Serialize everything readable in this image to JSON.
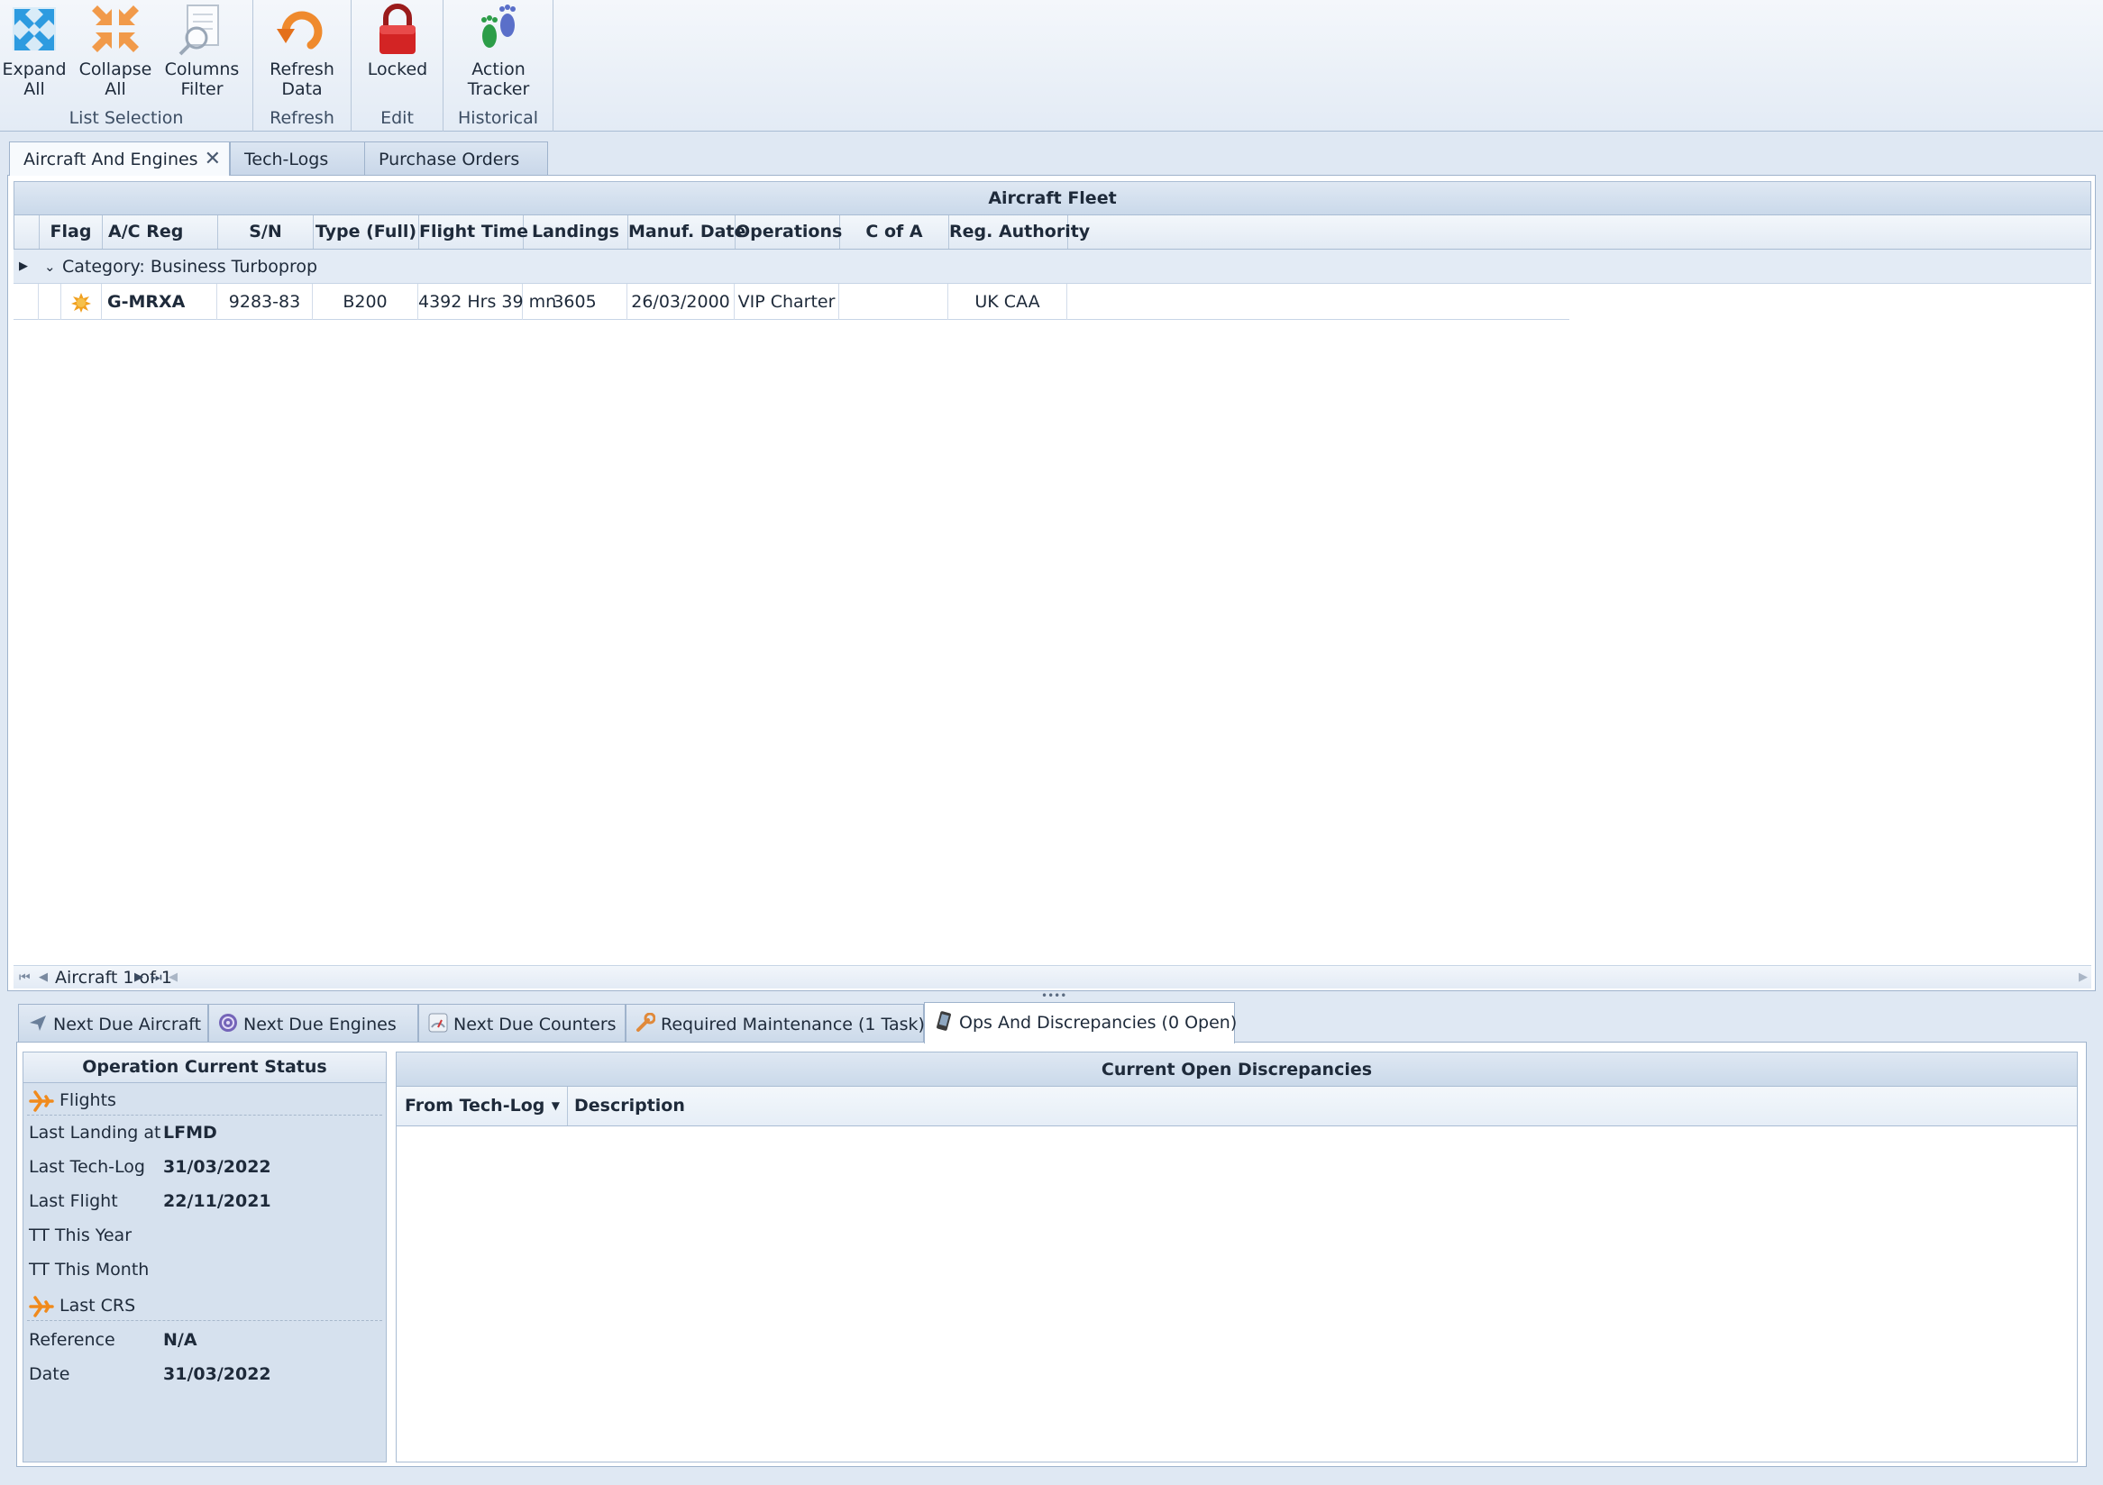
{
  "ribbon": {
    "groups": [
      {
        "label": "List Selection"
      },
      {
        "label": "Refresh"
      },
      {
        "label": "Edit"
      },
      {
        "label": "Historical"
      }
    ],
    "buttons": {
      "expand_all": "Expand\nAll",
      "collapse_all": "Collapse\nAll",
      "columns_filter": "Columns\nFilter",
      "refresh_data": "Refresh\nData",
      "locked": "Locked",
      "action_tracker": "Action\nTracker"
    }
  },
  "doc_tabs": [
    {
      "label": "Aircraft And Engines",
      "active": true
    },
    {
      "label": "Tech-Logs",
      "active": false
    },
    {
      "label": "Purchase Orders",
      "active": false
    }
  ],
  "fleet_grid": {
    "title": "Aircraft Fleet",
    "columns": [
      "Flag",
      "A/C Reg",
      "S/N",
      "Type (Full)",
      "Flight Time",
      "Landings",
      "Manuf. Date",
      "Operations",
      "C of A",
      "Reg. Authority"
    ],
    "group_label": "Category: Business Turboprop",
    "rows": [
      {
        "flag_icon": "sun-icon",
        "reg": "G-MRXA",
        "sn": "9283-83",
        "type": "B200",
        "flight_time": "4392 Hrs 39 mn",
        "landings": "3605",
        "manuf_date": "26/03/2000",
        "operations": "VIP Charter",
        "cofa": "",
        "authority": "UK CAA"
      }
    ],
    "pager_text": "Aircraft 1 of 1"
  },
  "bottom_tabs": [
    {
      "label": "Next Due Aircraft",
      "icon": "airplane-icon",
      "active": false
    },
    {
      "label": "Next Due Engines",
      "icon": "engine-icon",
      "active": false
    },
    {
      "label": "Next Due Counters",
      "icon": "gauge-icon",
      "active": false
    },
    {
      "label": "Required Maintenance (1 Task)",
      "icon": "wrench-icon",
      "active": false
    },
    {
      "label": "Ops And Discrepancies (0 Open)",
      "icon": "phone-icon",
      "active": true
    }
  ],
  "status": {
    "title": "Operation Current Status",
    "flights_section": "Flights",
    "last_landing_label": "Last Landing at",
    "last_landing_value": "LFMD",
    "last_techlog_label": "Last Tech-Log",
    "last_techlog_value": "31/03/2022",
    "last_flight_label": "Last Flight",
    "last_flight_value": "22/11/2021",
    "tt_year_label": "TT This Year",
    "tt_year_value": "",
    "tt_month_label": "TT This Month",
    "tt_month_value": "",
    "crs_section": "Last CRS",
    "reference_label": "Reference",
    "reference_value": "N/A",
    "date_label": "Date",
    "date_value": "31/03/2022"
  },
  "discrepancies": {
    "title": "Current Open Discrepancies",
    "columns": [
      "From Tech-Log",
      "Description"
    ]
  },
  "colors": {
    "accent": "#c9d7e9",
    "border": "#9fb3cc",
    "plane_orange": "#f08a1c"
  }
}
